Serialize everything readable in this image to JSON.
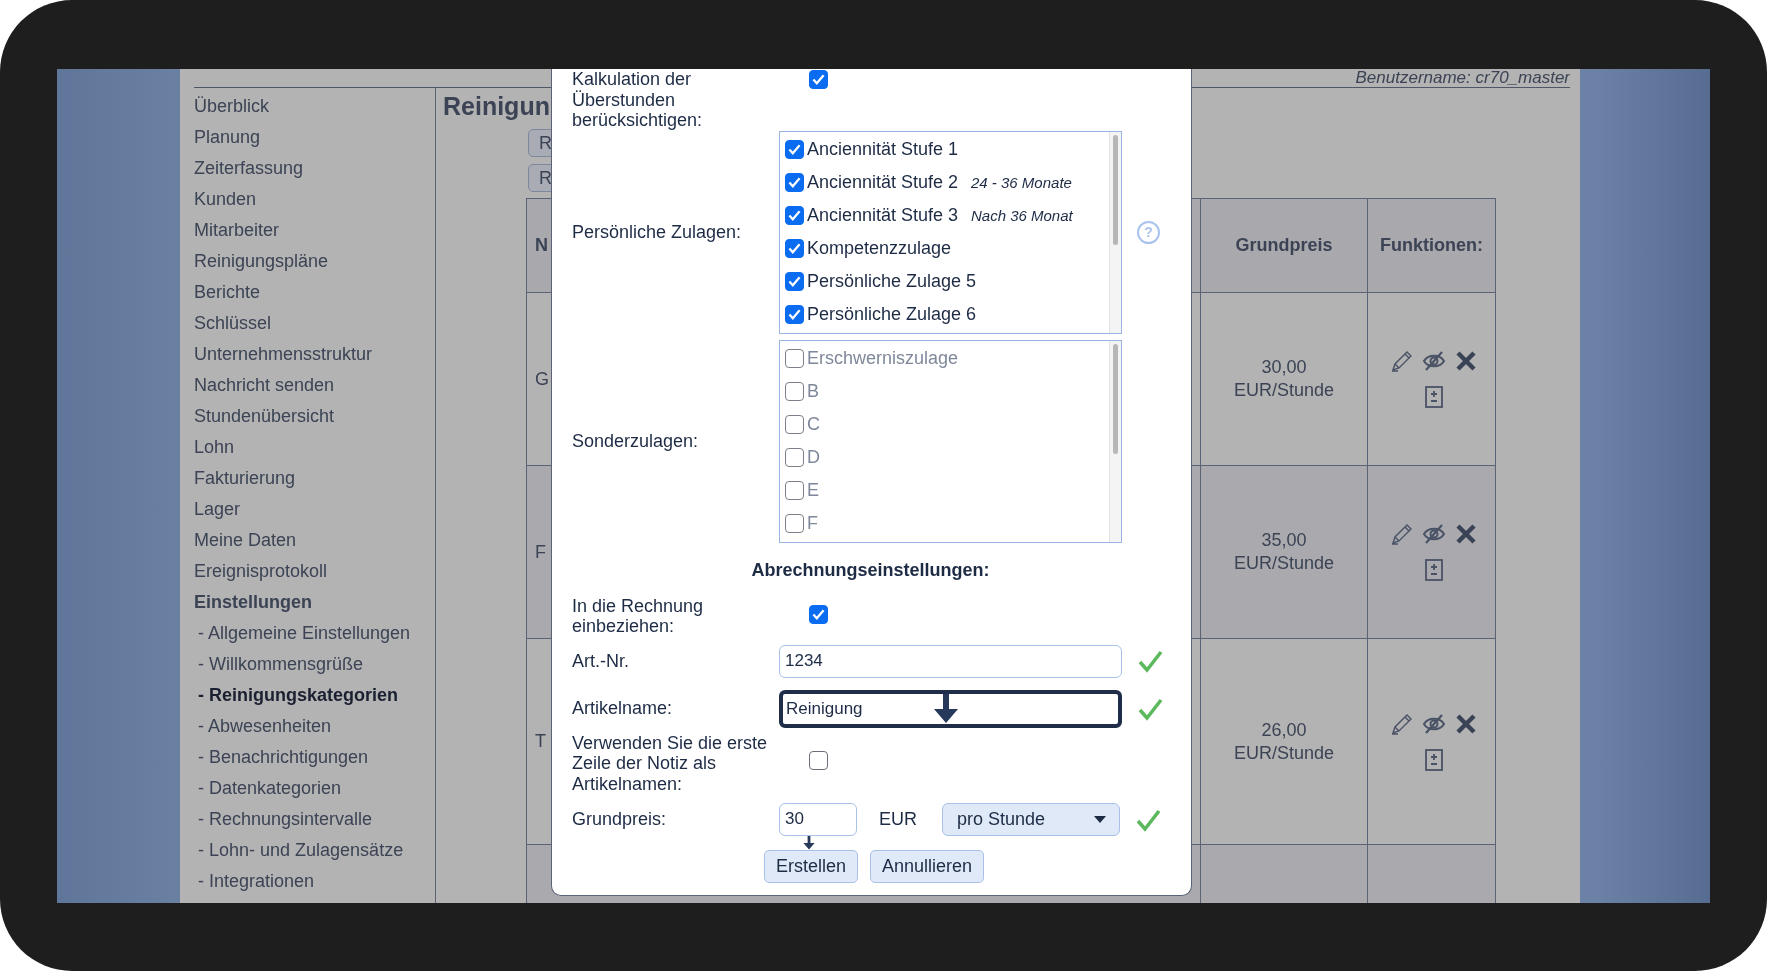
{
  "header": {
    "username": "Benutzername: cr70_master"
  },
  "sidebar": {
    "items": [
      {
        "label": "Überblick",
        "selected": false
      },
      {
        "label": "Planung",
        "selected": false
      },
      {
        "label": "Zeiterfassung",
        "selected": false
      },
      {
        "label": "Kunden",
        "selected": false
      },
      {
        "label": "Mitarbeiter",
        "selected": false
      },
      {
        "label": "Reinigungspläne",
        "selected": false
      },
      {
        "label": "Berichte",
        "selected": false
      },
      {
        "label": "Schlüssel",
        "selected": false
      },
      {
        "label": "Unternehmensstruktur",
        "selected": false
      },
      {
        "label": "Nachricht senden",
        "selected": false
      },
      {
        "label": "Stundenübersicht",
        "selected": false
      },
      {
        "label": "Lohn",
        "selected": false
      },
      {
        "label": "Fakturierung",
        "selected": false
      },
      {
        "label": "Lager",
        "selected": false
      },
      {
        "label": "Meine Daten",
        "selected": false
      },
      {
        "label": "Ereignisprotokoll",
        "selected": false
      },
      {
        "label": "Einstellungen",
        "selected": false,
        "expanded": true,
        "children": [
          {
            "label": "- Allgemeine Einstellungen",
            "selected": false
          },
          {
            "label": "- Willkommensgrüße",
            "selected": false
          },
          {
            "label": "- Reinigungskategorien",
            "selected": true
          },
          {
            "label": "- Abwesenheiten",
            "selected": false
          },
          {
            "label": "- Benachrichtigungen",
            "selected": false
          },
          {
            "label": "- Datenkategorien",
            "selected": false
          },
          {
            "label": "- Rechnungsintervalle",
            "selected": false
          },
          {
            "label": "- Lohn- und Zulagensätze",
            "selected": false
          },
          {
            "label": "- Integrationen",
            "selected": false
          }
        ]
      }
    ]
  },
  "main": {
    "heading": "Reinigun",
    "buttons": [
      "R",
      "R"
    ],
    "table": {
      "columns": [
        "N",
        "Grundpreis",
        "Funktionen:"
      ],
      "rows": [
        {
          "cells": [
            "G",
            "30,00 EUR/Stunde"
          ]
        },
        {
          "cells": [
            "F",
            "35,00 EUR/Stunde"
          ]
        },
        {
          "cells": [
            "T",
            "26,00 EUR/Stunde"
          ]
        }
      ]
    }
  },
  "modal": {
    "rows": [
      {
        "kind": "checkbox",
        "label": "Kalkulation der Überstunden berücksichtigen:",
        "checked": true
      },
      {
        "kind": "checklist",
        "label": "Persönliche Zulagen:",
        "help": "?",
        "disabled": false,
        "items": [
          {
            "label": "Anciennität Stufe 1",
            "checked": true
          },
          {
            "label": "Anciennität Stufe 2",
            "note": "24 - 36 Monate",
            "checked": true
          },
          {
            "label": "Anciennität Stufe 3",
            "note": "Nach 36 Monat",
            "checked": true
          },
          {
            "label": "Kompetenzzulage",
            "checked": true
          },
          {
            "label": "Persönliche Zulage 5",
            "checked": true
          },
          {
            "label": "Persönliche Zulage 6",
            "checked": true
          }
        ]
      },
      {
        "kind": "checklist",
        "label": "Sonderzulagen:",
        "disabled": true,
        "items": [
          {
            "label": "Erschwerniszulage",
            "checked": false
          },
          {
            "label": "B",
            "checked": false
          },
          {
            "label": "C",
            "checked": false
          },
          {
            "label": "D",
            "checked": false
          },
          {
            "label": "E",
            "checked": false
          },
          {
            "label": "F",
            "checked": false
          }
        ]
      },
      {
        "kind": "heading",
        "label": "Abrechnungseinstellungen:"
      },
      {
        "kind": "checkbox",
        "label": "In die Rechnung einbeziehen:",
        "checked": true
      },
      {
        "kind": "text",
        "label": "Art.-Nr.",
        "value": "1234",
        "valid": true,
        "focused": false,
        "arrow": false
      },
      {
        "kind": "text",
        "label": "Artikelname:",
        "value": "Reinigung",
        "valid": true,
        "focused": true,
        "arrow": true
      },
      {
        "kind": "checkbox",
        "label": "Verwenden Sie die erste Zeile der Notiz als Artikelnamen:",
        "checked": false
      },
      {
        "kind": "price",
        "label": "Grundpreis:",
        "value": "30",
        "unit": "EUR",
        "select": "pro Stunde",
        "valid": true
      }
    ],
    "buttons": [
      {
        "label": "Erstellen",
        "arrow": true
      },
      {
        "label": "Annullieren",
        "arrow": false
      }
    ]
  }
}
